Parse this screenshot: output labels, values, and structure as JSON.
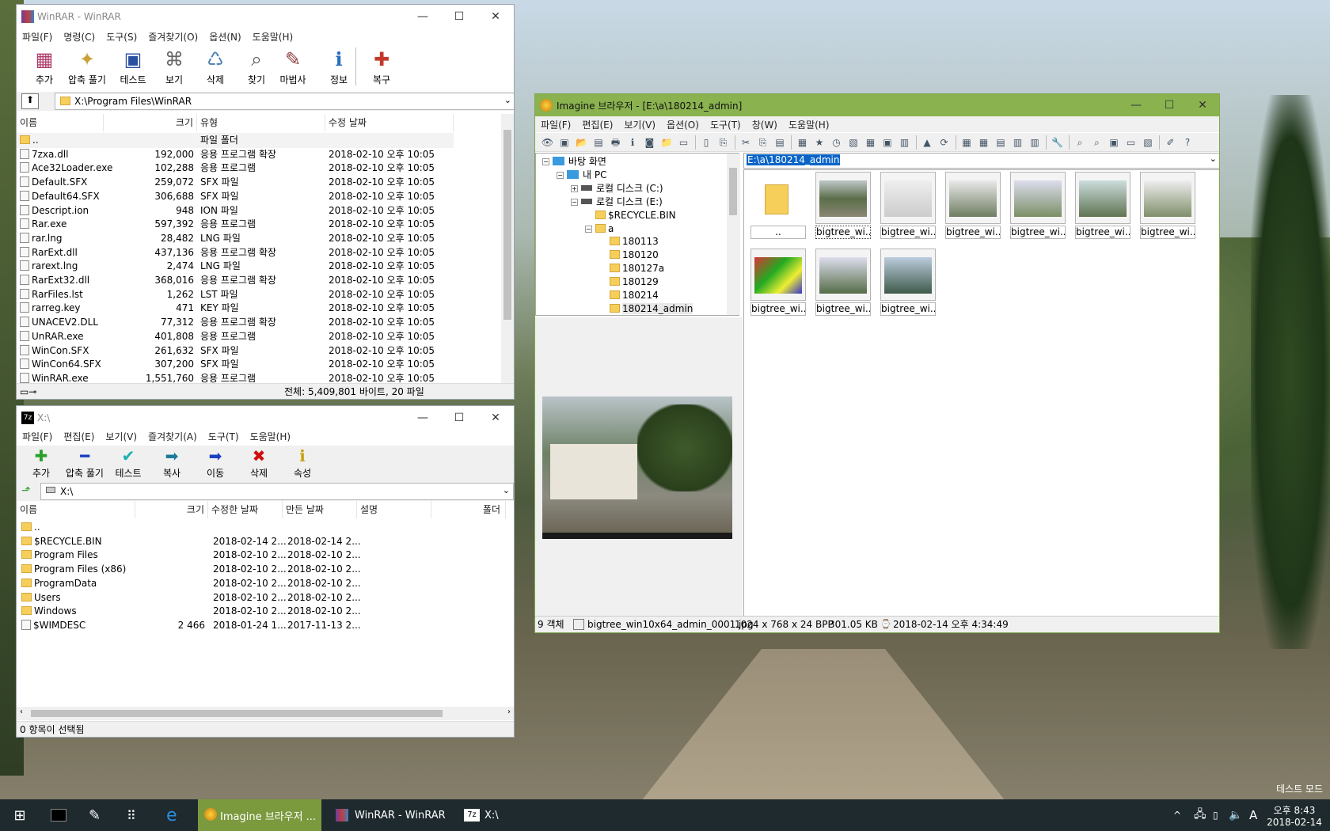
{
  "winrar": {
    "title": "WinRAR - WinRAR",
    "menu": [
      "파일(F)",
      "명령(C)",
      "도구(S)",
      "즐겨찾기(O)",
      "옵션(N)",
      "도움말(H)"
    ],
    "tools": [
      "추가",
      "압축 풀기",
      "테스트",
      "보기",
      "삭제",
      "찾기",
      "마법사",
      "정보",
      "복구"
    ],
    "path": "X:\\Program Files\\WinRAR",
    "columns": [
      "이름",
      "크기",
      "유형",
      "수정 날짜"
    ],
    "rows": [
      {
        "name": "..",
        "size": "",
        "type": "파일 폴더",
        "date": ""
      },
      {
        "name": "7zxa.dll",
        "size": "192,000",
        "type": "응용 프로그램 확장",
        "date": "2018-02-10 오후 10:05"
      },
      {
        "name": "Ace32Loader.exe",
        "size": "102,288",
        "type": "응용 프로그램",
        "date": "2018-02-10 오후 10:05"
      },
      {
        "name": "Default.SFX",
        "size": "259,072",
        "type": "SFX 파일",
        "date": "2018-02-10 오후 10:05"
      },
      {
        "name": "Default64.SFX",
        "size": "306,688",
        "type": "SFX 파일",
        "date": "2018-02-10 오후 10:05"
      },
      {
        "name": "Descript.ion",
        "size": "948",
        "type": "ION 파일",
        "date": "2018-02-10 오후 10:05"
      },
      {
        "name": "Rar.exe",
        "size": "597,392",
        "type": "응용 프로그램",
        "date": "2018-02-10 오후 10:05"
      },
      {
        "name": "rar.lng",
        "size": "28,482",
        "type": "LNG 파일",
        "date": "2018-02-10 오후 10:05"
      },
      {
        "name": "RarExt.dll",
        "size": "437,136",
        "type": "응용 프로그램 확장",
        "date": "2018-02-10 오후 10:05"
      },
      {
        "name": "rarext.lng",
        "size": "2,474",
        "type": "LNG 파일",
        "date": "2018-02-10 오후 10:05"
      },
      {
        "name": "RarExt32.dll",
        "size": "368,016",
        "type": "응용 프로그램 확장",
        "date": "2018-02-10 오후 10:05"
      },
      {
        "name": "RarFiles.lst",
        "size": "1,262",
        "type": "LST 파일",
        "date": "2018-02-10 오후 10:05"
      },
      {
        "name": "rarreg.key",
        "size": "471",
        "type": "KEY 파일",
        "date": "2018-02-10 오후 10:05"
      },
      {
        "name": "UNACEV2.DLL",
        "size": "77,312",
        "type": "응용 프로그램 확장",
        "date": "2018-02-10 오후 10:05"
      },
      {
        "name": "UnRAR.exe",
        "size": "401,808",
        "type": "응용 프로그램",
        "date": "2018-02-10 오후 10:05"
      },
      {
        "name": "WinCon.SFX",
        "size": "261,632",
        "type": "SFX 파일",
        "date": "2018-02-10 오후 10:05"
      },
      {
        "name": "WinCon64.SFX",
        "size": "307,200",
        "type": "SFX 파일",
        "date": "2018-02-10 오후 10:05"
      },
      {
        "name": "WinRAR.exe",
        "size": "1,551,760",
        "type": "응용 프로그램",
        "date": "2018-02-10 오후 10:05"
      }
    ],
    "status": "전체: 5,409,801 바이트, 20 파일"
  },
  "sevenzip": {
    "title": "X:\\",
    "menu": [
      "파일(F)",
      "편집(E)",
      "보기(V)",
      "즐겨찾기(A)",
      "도구(T)",
      "도움말(H)"
    ],
    "tools": [
      "추가",
      "압축 풀기",
      "테스트",
      "복사",
      "이동",
      "삭제",
      "속성"
    ],
    "path": "X:\\",
    "columns": [
      "이름",
      "크기",
      "수정한 날짜",
      "만든 날짜",
      "설명",
      "폴더"
    ],
    "rows": [
      {
        "name": "..",
        "size": "",
        "mod": "",
        "created": ""
      },
      {
        "name": "$RECYCLE.BIN",
        "size": "",
        "mod": "2018-02-14 2...",
        "created": "2018-02-14 2..."
      },
      {
        "name": "Program Files",
        "size": "",
        "mod": "2018-02-10 2...",
        "created": "2018-02-10 2..."
      },
      {
        "name": "Program Files (x86)",
        "size": "",
        "mod": "2018-02-10 2...",
        "created": "2018-02-10 2..."
      },
      {
        "name": "ProgramData",
        "size": "",
        "mod": "2018-02-10 2...",
        "created": "2018-02-10 2..."
      },
      {
        "name": "Users",
        "size": "",
        "mod": "2018-02-10 2...",
        "created": "2018-02-10 2..."
      },
      {
        "name": "Windows",
        "size": "",
        "mod": "2018-02-10 2...",
        "created": "2018-02-10 2..."
      },
      {
        "name": "$WIMDESC",
        "size": "2 466",
        "mod": "2018-01-24 1...",
        "created": "2017-11-13 2..."
      }
    ],
    "status": "0 항목이 선택됨"
  },
  "imagine": {
    "title": "Imagine 브라우저 - [E:\\a\\180214_admin]",
    "menu": [
      "파일(F)",
      "편집(E)",
      "보기(V)",
      "옵션(O)",
      "도구(T)",
      "창(W)",
      "도움말(H)"
    ],
    "address": "E:\\a\\180214_admin",
    "tree": [
      {
        "label": "바탕 화면",
        "level": 0
      },
      {
        "label": "내 PC",
        "level": 1
      },
      {
        "label": "로컬 디스크 (C:)",
        "level": 2
      },
      {
        "label": "로컬 디스크 (E:)",
        "level": 2
      },
      {
        "label": "$RECYCLE.BIN",
        "level": 3
      },
      {
        "label": "a",
        "level": 3
      },
      {
        "label": "180113",
        "level": 4
      },
      {
        "label": "180120",
        "level": 4
      },
      {
        "label": "180127a",
        "level": 4
      },
      {
        "label": "180129",
        "level": 4
      },
      {
        "label": "180214",
        "level": 4
      },
      {
        "label": "180214_admin",
        "level": 4
      }
    ],
    "thumbs": [
      "..",
      "bigtree_wi...",
      "bigtree_wi...",
      "bigtree_wi...",
      "bigtree_wi...",
      "bigtree_wi...",
      "bigtree_wi...",
      "bigtree_wi...",
      "bigtree_wi...",
      "bigtree_wi..."
    ],
    "status": {
      "count": "9 객체",
      "file": "bigtree_win10x64_admin_0001.jpg",
      "dims": "1024 x 768 x 24 BPP",
      "size": "301.05 KB",
      "date": "2018-02-14 오후 4:34:49"
    }
  },
  "desktop": {
    "test_mode": "테스트 모드"
  },
  "taskbar": {
    "items": [
      "Imagine 브라우저 ...",
      "WinRAR - WinRAR",
      "X:\\"
    ],
    "time": "오후 8:43",
    "date": "2018-02-14",
    "ime": "A"
  }
}
